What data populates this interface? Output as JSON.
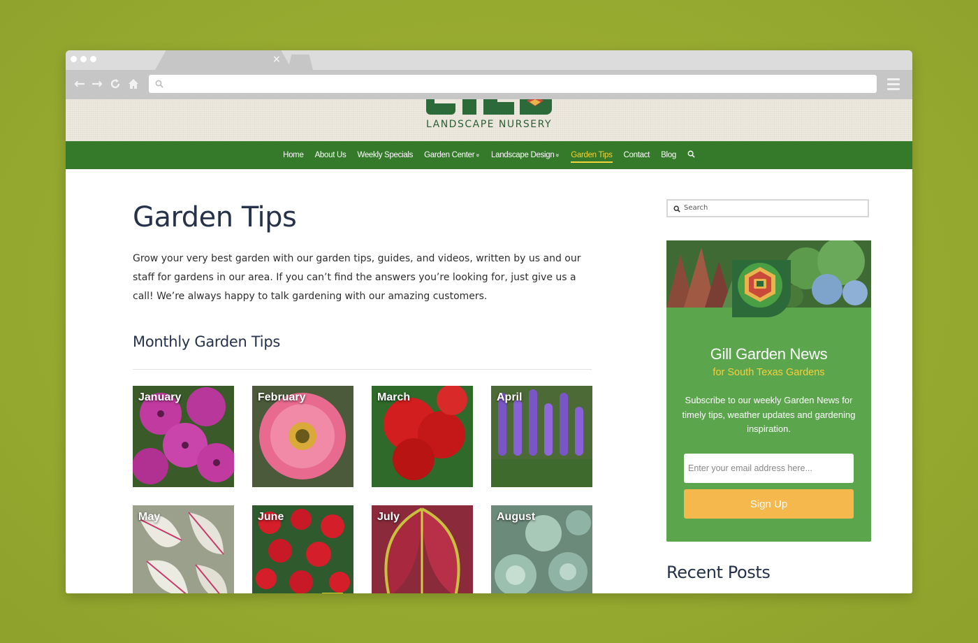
{
  "browser": {
    "tab_close": "×",
    "url": "",
    "icons": {
      "back": "back-arrow-icon",
      "forward": "forward-arrow-icon",
      "reload": "reload-icon",
      "home": "home-icon",
      "search": "search-icon",
      "menu": "hamburger-menu-icon"
    }
  },
  "site": {
    "logo_subtitle": "LANDSCAPE NURSERY",
    "nav": [
      {
        "label": "Home"
      },
      {
        "label": "About Us"
      },
      {
        "label": "Weekly Specials"
      },
      {
        "label": "Garden Center",
        "dropdown": true
      },
      {
        "label": "Landscape Design",
        "dropdown": true
      },
      {
        "label": "Garden Tips",
        "active": true
      },
      {
        "label": "Contact"
      },
      {
        "label": "Blog"
      }
    ],
    "nav_chevron": "»",
    "colors": {
      "nav_bg": "#347a2a",
      "nav_active": "#f2d33a",
      "card_bg": "#5ba64d",
      "button": "#f4b84d",
      "accent_yellow": "#f5cf3f",
      "heading": "#26324a"
    }
  },
  "main": {
    "title": "Garden Tips",
    "intro": "Grow your very best garden with our garden tips, guides, and videos, written by us and our staff for gardens in our area. If you can’t find the answers you’re looking for, just give us a call! We’re always happy to talk gardening with our amazing customers.",
    "section_title": "Monthly Garden Tips",
    "months": [
      {
        "label": "January"
      },
      {
        "label": "February"
      },
      {
        "label": "March"
      },
      {
        "label": "April"
      },
      {
        "label": "May"
      },
      {
        "label": "June"
      },
      {
        "label": "July"
      },
      {
        "label": "August"
      }
    ]
  },
  "sidebar": {
    "search_placeholder": "Search",
    "news": {
      "title": "Gill Garden News",
      "subtitle": "for South Texas Gardens",
      "description": "Subscribe to our weekly Garden News for timely tips, weather updates and gardening inspiration.",
      "email_placeholder": "Enter your email address here...",
      "button": "Sign Up"
    },
    "recent_title": "Recent Posts"
  }
}
